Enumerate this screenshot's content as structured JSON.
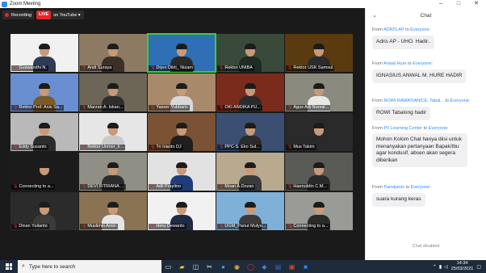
{
  "window": {
    "title": "Zoom Meeting",
    "controls": [
      "–",
      "□",
      "✕"
    ]
  },
  "recording": {
    "label": "Recording"
  },
  "live": {
    "badge": "LIVE",
    "label": "on YouTube ▾"
  },
  "participants": [
    {
      "name": "Guswandhi N.",
      "bg": "#f1f1f1",
      "shirt": "#2f3a55",
      "active": false
    },
    {
      "name": "Andi Suraya",
      "bg": "#8d7a63",
      "shirt": "#3b3028",
      "active": false
    },
    {
      "name": "Drjen Dikti_ Nizam",
      "bg": "#2f6fb5",
      "shirt": "#2a2a2a",
      "active": true
    },
    {
      "name": "Rektor UNIBA",
      "bg": "#3a4a3a",
      "shirt": "#1f2b24",
      "active": false
    },
    {
      "name": "Rektor USK Samsul",
      "bg": "#5a3b10",
      "shirt": "#2b2b2b",
      "active": false
    },
    {
      "name": "Rektor Prof. Anis Sa...",
      "bg": "#6a8fd1",
      "shirt": "#7a5a2a",
      "active": false
    },
    {
      "name": "Marzan A. Iskan...",
      "bg": "#6d6656",
      "shirt": "#2e2e2e",
      "active": false
    },
    {
      "name": "Yasser Yubbariz",
      "bg": "#a8896a",
      "shirt": "#d8d8d8",
      "active": false
    },
    {
      "name": "OKI ANDIKA PU...",
      "bg": "#7a2b1c",
      "shirt": "#2a2a2a",
      "active": false
    },
    {
      "name": "Agus Adi Nursal...",
      "bg": "#8a8a7e",
      "shirt": "#e8e8e8",
      "active": false
    },
    {
      "name": "Eddy Susanto",
      "bg": "#b9b9b9",
      "shirt": "#2c2c2c",
      "active": false
    },
    {
      "name": "Rektor Unmer_Ir...",
      "bg": "#e6e6e6",
      "shirt": "#c9c9c9",
      "active": false
    },
    {
      "name": "Tri Irianto DJ",
      "bg": "#7b5233",
      "shirt": "#1f1f1f",
      "active": false
    },
    {
      "name": "PPC-S. Eko Sul...",
      "bg": "#3a4f72",
      "shirt": "#2b2b2b",
      "active": false
    },
    {
      "name": "Mus Takim",
      "bg": "#2a2a2a",
      "shirt": "#2a2a2a",
      "active": false
    },
    {
      "name": "Connecting to a...",
      "bg": "#1b1b1b",
      "shirt": "#1b1b1b",
      "active": false
    },
    {
      "name": "DEVI FITRIANA ...",
      "bg": "#8f8f85",
      "shirt": "#2c2c2c",
      "active": false
    },
    {
      "name": "Adil Prayitno",
      "bg": "#e2e2e2",
      "shirt": "#1e3d7a",
      "active": false
    },
    {
      "name": "Moan A.Dozan",
      "bg": "#b8a98f",
      "shirt": "#3a3a3a",
      "active": false
    },
    {
      "name": "Haeruddin C.M...",
      "bg": "#5a5a56",
      "shirt": "#2a2a2a",
      "active": false
    },
    {
      "name": "Dinan Yulianto",
      "bg": "#2b2b2b",
      "shirt": "#3a3a3a",
      "active": false
    },
    {
      "name": "Muslimin Amin",
      "bg": "#8a7353",
      "shirt": "#e5e5e5",
      "active": false
    },
    {
      "name": "Heru Dewanto",
      "bg": "#f1f1f1",
      "shirt": "#1f2a44",
      "active": false
    },
    {
      "name": "UGM_Panut Mulyo...",
      "bg": "#7fb0d8",
      "shirt": "#3a3a3a",
      "active": false
    },
    {
      "name": "Connecting to a...",
      "bg": "#9a9a96",
      "shirt": "#2a2a2a",
      "active": false
    }
  ],
  "chat": {
    "title": "Chat",
    "messages": [
      {
        "from": "ADRIS.AP",
        "to": "Everyone",
        "text": "Adris AP - UHO. Hadir.."
      },
      {
        "from": "Anwal Hure",
        "to": "Everyone",
        "text": "IGNASIUS ANWAL M. HURE HADIR"
      },
      {
        "from": "ROWI RAWATIANICE, Tabal...",
        "to": "Everyone",
        "text": "ROWI Tabalong hadir"
      },
      {
        "from": "PII Learning Center",
        "to": "Everyone",
        "text": "Mohon Kolom Chat hanya diisi untuk menanyakan pertanyaan Bapak/Ibu agar kondusif, absen akan segera diberikan"
      },
      {
        "from": "Parwijanto",
        "to": "Everyone",
        "text": "suara kurang keras"
      }
    ],
    "footer": "Chat disabled"
  },
  "taskbar": {
    "search_placeholder": "Type here to search",
    "time": "14:34",
    "date": "25/03/2021"
  }
}
